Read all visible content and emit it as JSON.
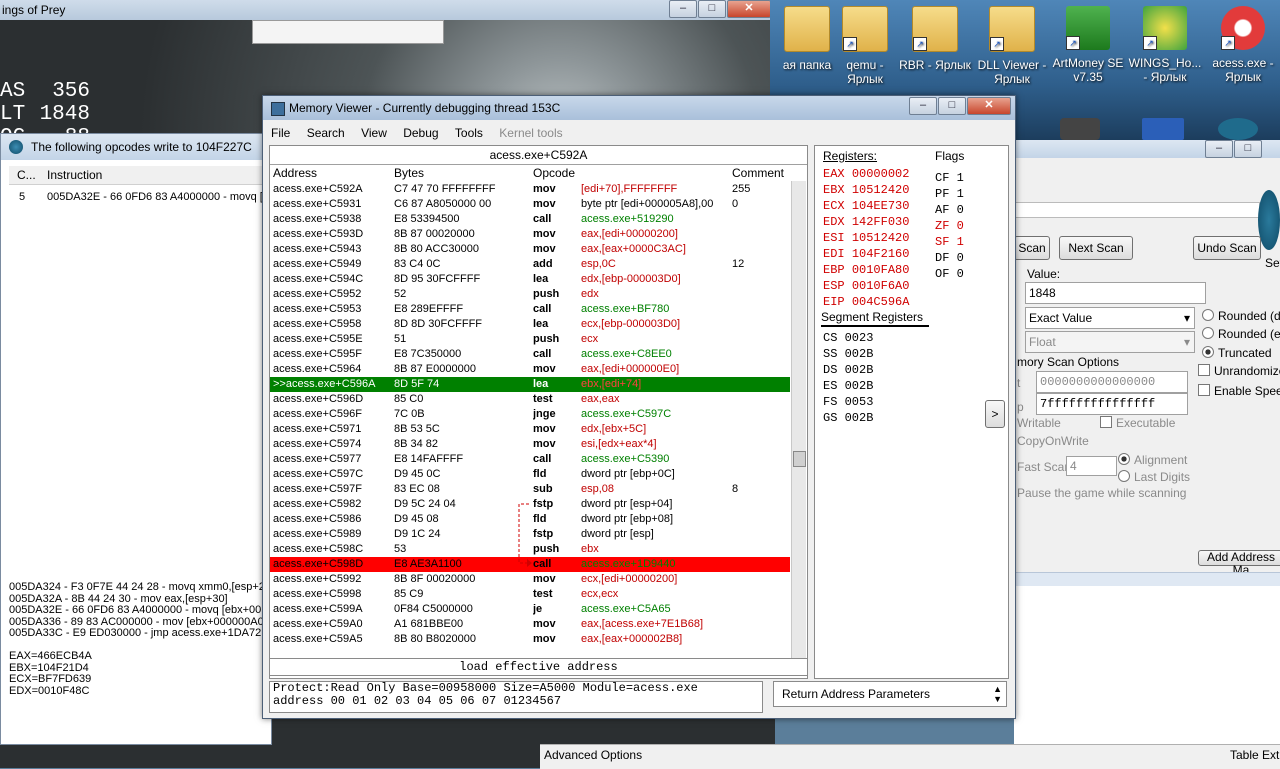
{
  "desktop": {
    "icons": [
      {
        "label": "ая папка"
      },
      {
        "label": "qemu -\nЯрлык"
      },
      {
        "label": "RBR - Ярлык"
      },
      {
        "label": "DLL Viewer -\nЯрлык"
      },
      {
        "label": "ArtMoney SE\nv7.35"
      },
      {
        "label": "WINGS_Ho...\n- Ярлык"
      },
      {
        "label": "acess.exe -\nЯрлык"
      }
    ]
  },
  "game": {
    "title": "ings of Prey",
    "hud": [
      {
        "label": "AS",
        "value": "356"
      },
      {
        "label": "LT",
        "value": "1848"
      },
      {
        "label": "OG",
        "value": "88"
      }
    ]
  },
  "opcodes_window": {
    "title": "The following opcodes write to 104F227C",
    "col_count": "C...",
    "col_instruction": "Instruction",
    "rows": [
      {
        "count": "5",
        "instruction": "005DA32E - 66 0FD6 83 A4000000 - movq [e"
      }
    ],
    "log": [
      "005DA324 - F3 0F7E 44 24 28 - movq xmm0,[esp+2",
      "005DA32A - 8B 44 24 30 - mov eax,[esp+30]",
      "005DA32E - 66 0FD6 83 A4000000 - movq [ebx+00",
      "005DA336 - 89 83 AC000000 - mov [ebx+000000A0",
      "005DA33C - E9 ED030000 - jmp acess.exe+1DA72E",
      "",
      "EAX=466ECB4A",
      "EBX=104F21D4",
      "ECX=BF7FD639",
      "EDX=0010F48C"
    ]
  },
  "memory_viewer": {
    "title": "Memory Viewer - Currently debugging thread 153C",
    "menu": [
      "File",
      "Search",
      "View",
      "Debug",
      "Tools",
      "Kernel tools"
    ],
    "header_address": "acess.exe+C592A",
    "columns": {
      "address": "Address",
      "bytes": "Bytes",
      "opcode": "Opcode",
      "comment": "Comment"
    },
    "rows": [
      {
        "addr": "acess.exe+C592A",
        "bytes": "C7 47 70 FFFFFFFF",
        "op": "mov",
        "args": "[edi+70],FFFFFFFF",
        "cmt": "255",
        "hl": ""
      },
      {
        "addr": "acess.exe+C5931",
        "bytes": "C6 87 A8050000 00",
        "op": "mov",
        "args": "byte ptr [edi+000005A8],00",
        "cmt": "0",
        "hl": ""
      },
      {
        "addr": "acess.exe+C5938",
        "bytes": "E8 53394500",
        "op": "call",
        "args": "acess.exe+519290",
        "cmt": "",
        "hl": ""
      },
      {
        "addr": "acess.exe+C593D",
        "bytes": "8B 87 00020000",
        "op": "mov",
        "args": "eax,[edi+00000200]",
        "cmt": "",
        "hl": ""
      },
      {
        "addr": "acess.exe+C5943",
        "bytes": "8B 80 ACC30000",
        "op": "mov",
        "args": "eax,[eax+0000C3AC]",
        "cmt": "",
        "hl": ""
      },
      {
        "addr": "acess.exe+C5949",
        "bytes": "83 C4 0C",
        "op": "add",
        "args": "esp,0C",
        "cmt": "12",
        "hl": ""
      },
      {
        "addr": "acess.exe+C594C",
        "bytes": "8D 95 30FCFFFF",
        "op": "lea",
        "args": "edx,[ebp-000003D0]",
        "cmt": "",
        "hl": ""
      },
      {
        "addr": "acess.exe+C5952",
        "bytes": "52",
        "op": "push",
        "args": "edx",
        "cmt": "",
        "hl": ""
      },
      {
        "addr": "acess.exe+C5953",
        "bytes": "E8 289EFFFF",
        "op": "call",
        "args": "acess.exe+BF780",
        "cmt": "",
        "hl": ""
      },
      {
        "addr": "acess.exe+C5958",
        "bytes": "8D 8D 30FCFFFF",
        "op": "lea",
        "args": "ecx,[ebp-000003D0]",
        "cmt": "",
        "hl": ""
      },
      {
        "addr": "acess.exe+C595E",
        "bytes": "51",
        "op": "push",
        "args": "ecx",
        "cmt": "",
        "hl": ""
      },
      {
        "addr": "acess.exe+C595F",
        "bytes": "E8 7C350000",
        "op": "call",
        "args": "acess.exe+C8EE0",
        "cmt": "",
        "hl": ""
      },
      {
        "addr": "acess.exe+C5964",
        "bytes": "8B 87 E0000000",
        "op": "mov",
        "args": "eax,[edi+000000E0]",
        "cmt": "",
        "hl": ""
      },
      {
        "addr": ">>acess.exe+C596A",
        "bytes": "8D 5F 74",
        "op": "lea",
        "args": "ebx,[edi+74]",
        "cmt": "",
        "hl": "green"
      },
      {
        "addr": "acess.exe+C596D",
        "bytes": "85 C0",
        "op": "test",
        "args": "eax,eax",
        "cmt": "",
        "hl": ""
      },
      {
        "addr": "acess.exe+C596F",
        "bytes": "7C 0B",
        "op": "jnge",
        "args": "acess.exe+C597C",
        "cmt": "",
        "hl": ""
      },
      {
        "addr": "acess.exe+C5971",
        "bytes": "8B 53 5C",
        "op": "mov",
        "args": "edx,[ebx+5C]",
        "cmt": "",
        "hl": ""
      },
      {
        "addr": "acess.exe+C5974",
        "bytes": "8B 34 82",
        "op": "mov",
        "args": "esi,[edx+eax*4]",
        "cmt": "",
        "hl": ""
      },
      {
        "addr": "acess.exe+C5977",
        "bytes": "E8 14FAFFFF",
        "op": "call",
        "args": "acess.exe+C5390",
        "cmt": "",
        "hl": ""
      },
      {
        "addr": "acess.exe+C597C",
        "bytes": "D9 45 0C",
        "op": "fld",
        "args": "dword ptr [ebp+0C]",
        "cmt": "",
        "hl": ""
      },
      {
        "addr": "acess.exe+C597F",
        "bytes": "83 EC 08",
        "op": "sub",
        "args": "esp,08",
        "cmt": "8",
        "hl": ""
      },
      {
        "addr": "acess.exe+C5982",
        "bytes": "D9 5C 24 04",
        "op": "fstp",
        "args": "dword ptr [esp+04]",
        "cmt": "",
        "hl": ""
      },
      {
        "addr": "acess.exe+C5986",
        "bytes": "D9 45 08",
        "op": "fld",
        "args": "dword ptr [ebp+08]",
        "cmt": "",
        "hl": ""
      },
      {
        "addr": "acess.exe+C5989",
        "bytes": "D9 1C 24",
        "op": "fstp",
        "args": "dword ptr [esp]",
        "cmt": "",
        "hl": ""
      },
      {
        "addr": "acess.exe+C598C",
        "bytes": "53",
        "op": "push",
        "args": "ebx",
        "cmt": "",
        "hl": ""
      },
      {
        "addr": "acess.exe+C598D",
        "bytes": "E8 AE3A1100",
        "op": "call",
        "args": "acess.exe+1D9440",
        "cmt": "",
        "hl": "red"
      },
      {
        "addr": "acess.exe+C5992",
        "bytes": "8B 8F 00020000",
        "op": "mov",
        "args": "ecx,[edi+00000200]",
        "cmt": "",
        "hl": ""
      },
      {
        "addr": "acess.exe+C5998",
        "bytes": "85 C9",
        "op": "test",
        "args": "ecx,ecx",
        "cmt": "",
        "hl": ""
      },
      {
        "addr": "acess.exe+C599A",
        "bytes": "0F84 C5000000",
        "op": "je",
        "args": "acess.exe+C5A65",
        "cmt": "",
        "hl": ""
      },
      {
        "addr": "acess.exe+C59A0",
        "bytes": "A1 681BBE00",
        "op": "mov",
        "args": "eax,[acess.exe+7E1B68]",
        "cmt": "",
        "hl": ""
      },
      {
        "addr": "acess.exe+C59A5",
        "bytes": "8B 80 B8020000",
        "op": "mov",
        "args": "eax,[eax+000002B8]",
        "cmt": "",
        "hl": ""
      }
    ],
    "instruction_desc": "load effective address",
    "hex_line1": "Protect:Read Only  Base=00958000 Size=A5000 Module=acess.exe",
    "hex_line2": "address  00 01 02 03 04 05 06 07 01234567",
    "stack_return": "Return Address",
    "stack_params": "Parameters",
    "registers_title": "Registers:",
    "registers": [
      {
        "name": "EAX",
        "value": "00000002",
        "changed": true
      },
      {
        "name": "EBX",
        "value": "10512420",
        "changed": true
      },
      {
        "name": "ECX",
        "value": "104EE730",
        "changed": true
      },
      {
        "name": "EDX",
        "value": "142FF030",
        "changed": true
      },
      {
        "name": "ESI",
        "value": "10512420",
        "changed": true
      },
      {
        "name": "EDI",
        "value": "104F2160",
        "changed": true
      },
      {
        "name": "EBP",
        "value": "0010FA80",
        "changed": true
      },
      {
        "name": "ESP",
        "value": "0010F6A0",
        "changed": true
      },
      {
        "name": "EIP",
        "value": "004C596A",
        "changed": true
      }
    ],
    "flags_title": "Flags",
    "flags": [
      {
        "name": "CF",
        "value": "1",
        "changed": false
      },
      {
        "name": "PF",
        "value": "1",
        "changed": false
      },
      {
        "name": "AF",
        "value": "0",
        "changed": false
      },
      {
        "name": "ZF",
        "value": "0",
        "changed": true
      },
      {
        "name": "SF",
        "value": "1",
        "changed": true
      },
      {
        "name": "DF",
        "value": "0",
        "changed": false
      },
      {
        "name": "OF",
        "value": "0",
        "changed": false
      }
    ],
    "segments_title": "Segment Registers",
    "segments": [
      {
        "name": "CS",
        "value": "0023"
      },
      {
        "name": "SS",
        "value": "002B"
      },
      {
        "name": "DS",
        "value": "002B"
      },
      {
        "name": "ES",
        "value": "002B"
      },
      {
        "name": "FS",
        "value": "0053"
      },
      {
        "name": "GS",
        "value": "002B"
      }
    ],
    "expand_button": ">"
  },
  "cheat_engine": {
    "first_scan": "Scan",
    "next_scan": "Next Scan",
    "undo_scan": "Undo Scan",
    "settings": "Set",
    "value_label": "Value:",
    "value": "1848",
    "scan_type": "Exact Value",
    "value_type": "Float",
    "rounded_default": "Rounded (de",
    "rounded_extreme": "Rounded (ex",
    "truncated": "Truncated",
    "unrandomizer": "Unrandomizer",
    "enable_speedhack": "Enable Speed",
    "mem_scan_options": "mory Scan Options",
    "start_label": "t",
    "start_value": "0000000000000000",
    "stop_label": "p",
    "stop_value": "7fffffffffffffff",
    "writable": "Writable",
    "executable": "Executable",
    "copy_on_write": "CopyOnWrite",
    "fast_scan": "Fast Scan",
    "fast_scan_value": "4",
    "alignment": "Alignment",
    "last_digits": "Last Digits",
    "pause_game": "Pause the game while scanning",
    "add_address": "Add Address Ma",
    "advanced_options": "Advanced Options",
    "table_extras": "Table Extr"
  }
}
